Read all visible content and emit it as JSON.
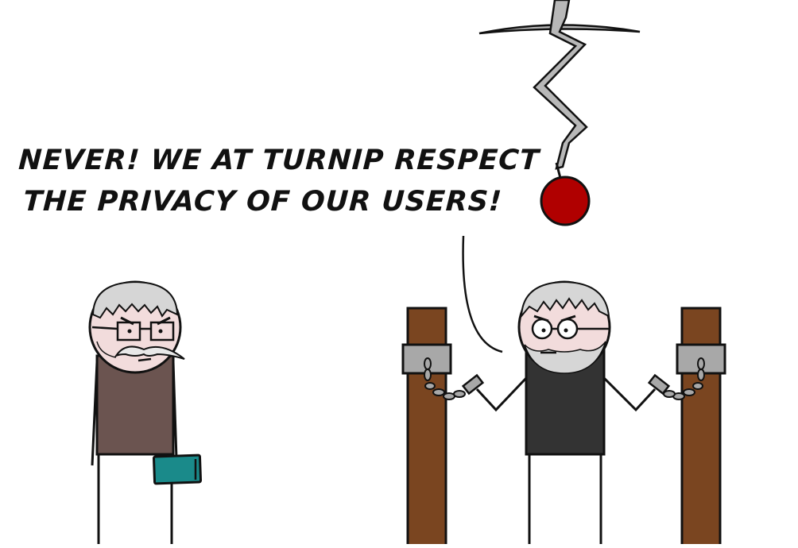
{
  "speech_bubble": {
    "line1": "NEVER! WE AT TURNIP RESPECT",
    "line2": "THE PRIVACY OF OUR USERS!"
  },
  "colors": {
    "outline": "#111111",
    "skin": "#f2dcdc",
    "hair": "#d6d6d6",
    "old_man_shirt": "#6b5450",
    "chained_man_shirt": "#333333",
    "post_wood": "#7a4520",
    "shackle": "#a8a8a8",
    "phone": "#1a8a8a",
    "pickaxe_metal": "#b8b8b8",
    "ball": "#b00000"
  },
  "icons": [
    "pickaxe-icon",
    "ball-icon",
    "phone-icon",
    "chain-icon",
    "shackle-icon"
  ]
}
